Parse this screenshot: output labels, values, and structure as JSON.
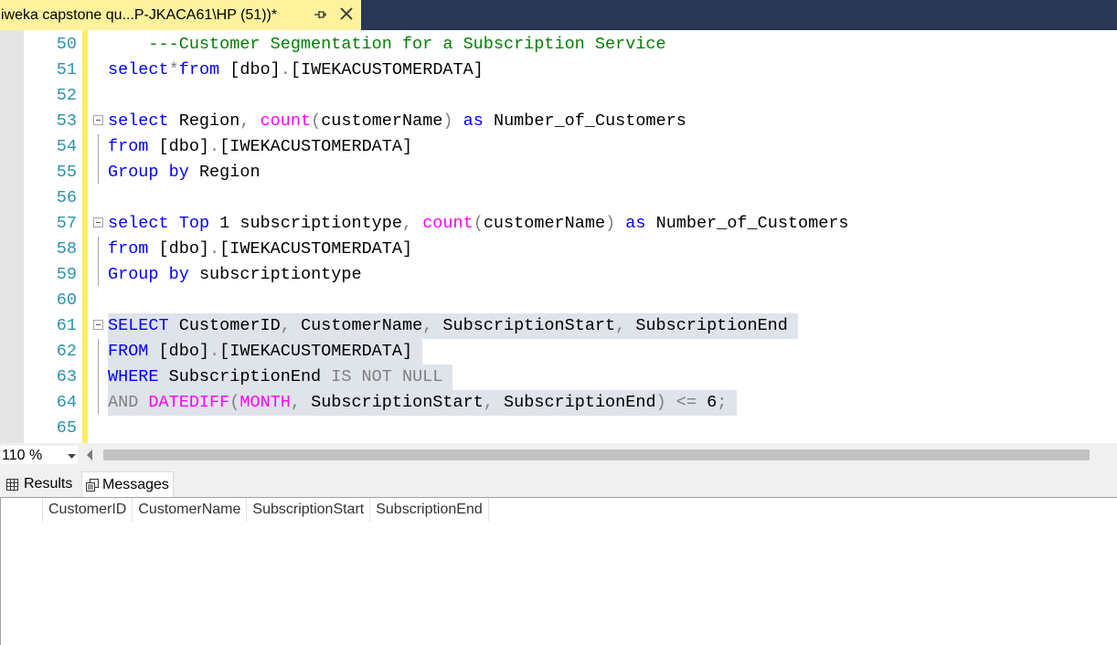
{
  "tab": {
    "title": "iweka capstone qu...P-JKACA61\\HP (51))*"
  },
  "editor": {
    "lines": [
      {
        "num": "50",
        "tokens": [
          {
            "t": "    ---Customer Segmentation for a Subscription Service",
            "c": "cm"
          }
        ]
      },
      {
        "num": "51",
        "tokens": [
          {
            "t": "select",
            "c": "kw"
          },
          {
            "t": "*",
            "c": "gr"
          },
          {
            "t": "from",
            "c": "kw"
          },
          {
            "t": " [dbo]"
          },
          {
            "t": ".",
            "c": "gr"
          },
          {
            "t": "[IWEKACUSTOMERDATA]"
          }
        ]
      },
      {
        "num": "52",
        "tokens": []
      },
      {
        "num": "53",
        "fold": true,
        "tokens": [
          {
            "t": "select",
            "c": "kw"
          },
          {
            "t": " Region"
          },
          {
            "t": ",",
            "c": "gr"
          },
          {
            "t": " "
          },
          {
            "t": "count",
            "c": "fn"
          },
          {
            "t": "(",
            "c": "gr"
          },
          {
            "t": "customerName"
          },
          {
            "t": ")",
            "c": "gr"
          },
          {
            "t": " "
          },
          {
            "t": "as",
            "c": "kw"
          },
          {
            "t": " Number_of_Customers"
          }
        ]
      },
      {
        "num": "54",
        "tokens": [
          {
            "t": "from",
            "c": "kw"
          },
          {
            "t": " [dbo]"
          },
          {
            "t": ".",
            "c": "gr"
          },
          {
            "t": "[IWEKACUSTOMERDATA]"
          }
        ]
      },
      {
        "num": "55",
        "tokens": [
          {
            "t": "Group",
            "c": "kw"
          },
          {
            "t": " "
          },
          {
            "t": "by",
            "c": "kw"
          },
          {
            "t": " Region"
          }
        ]
      },
      {
        "num": "56",
        "tokens": []
      },
      {
        "num": "57",
        "fold": true,
        "tokens": [
          {
            "t": "select",
            "c": "kw"
          },
          {
            "t": " "
          },
          {
            "t": "Top",
            "c": "kw"
          },
          {
            "t": " 1 subscriptiontype"
          },
          {
            "t": ",",
            "c": "gr"
          },
          {
            "t": " "
          },
          {
            "t": "count",
            "c": "fn"
          },
          {
            "t": "(",
            "c": "gr"
          },
          {
            "t": "customerName"
          },
          {
            "t": ")",
            "c": "gr"
          },
          {
            "t": " "
          },
          {
            "t": "as",
            "c": "kw"
          },
          {
            "t": " Number_of_Customers"
          }
        ]
      },
      {
        "num": "58",
        "tokens": [
          {
            "t": "from",
            "c": "kw"
          },
          {
            "t": " [dbo]"
          },
          {
            "t": ".",
            "c": "gr"
          },
          {
            "t": "[IWEKACUSTOMERDATA]"
          }
        ]
      },
      {
        "num": "59",
        "tokens": [
          {
            "t": "Group",
            "c": "kw"
          },
          {
            "t": " "
          },
          {
            "t": "by",
            "c": "kw"
          },
          {
            "t": " subscriptiontype"
          }
        ]
      },
      {
        "num": "60",
        "tokens": []
      },
      {
        "num": "61",
        "fold": true,
        "selected": true,
        "tokens": [
          {
            "t": "SELECT",
            "c": "kw"
          },
          {
            "t": " CustomerID"
          },
          {
            "t": ",",
            "c": "gr"
          },
          {
            "t": " CustomerName"
          },
          {
            "t": ",",
            "c": "gr"
          },
          {
            "t": " SubscriptionStart"
          },
          {
            "t": ",",
            "c": "gr"
          },
          {
            "t": " SubscriptionEnd "
          }
        ]
      },
      {
        "num": "62",
        "selected": true,
        "tokens": [
          {
            "t": "FROM",
            "c": "kw"
          },
          {
            "t": " [dbo]"
          },
          {
            "t": ".",
            "c": "gr"
          },
          {
            "t": "[IWEKACUSTOMERDATA] "
          }
        ]
      },
      {
        "num": "63",
        "selected": true,
        "tokens": [
          {
            "t": "WHERE",
            "c": "kw"
          },
          {
            "t": " SubscriptionEnd "
          },
          {
            "t": "IS NOT NULL ",
            "c": "gr"
          }
        ]
      },
      {
        "num": "64",
        "selected": true,
        "tokens": [
          {
            "t": "AND",
            "c": "gr"
          },
          {
            "t": " "
          },
          {
            "t": "DATEDIFF",
            "c": "fn"
          },
          {
            "t": "(",
            "c": "gr"
          },
          {
            "t": "MONTH",
            "c": "fn"
          },
          {
            "t": ",",
            "c": "gr"
          },
          {
            "t": " SubscriptionStart"
          },
          {
            "t": ",",
            "c": "gr"
          },
          {
            "t": " SubscriptionEnd"
          },
          {
            "t": ")",
            "c": "gr"
          },
          {
            "t": " "
          },
          {
            "t": "<=",
            "c": "gr"
          },
          {
            "t": " 6"
          },
          {
            "t": ";",
            "c": "gr"
          },
          {
            "t": " "
          }
        ]
      },
      {
        "num": "65",
        "tokens": []
      }
    ]
  },
  "zoom": {
    "value": "110 %"
  },
  "results": {
    "tabs": {
      "results_label": "Results",
      "messages_label": "Messages"
    },
    "columns": [
      "CustomerID",
      "CustomerName",
      "SubscriptionStart",
      "SubscriptionEnd"
    ]
  },
  "colors": {
    "tab_strip": "#293955",
    "active_tab": "#fff29d",
    "keyword": "#0000ff",
    "function": "#ff00ff",
    "comment": "#008000",
    "operator": "#808080",
    "line_number": "#2b91af",
    "selection": "#dfe3ea",
    "change_bar": "#ffee62"
  }
}
